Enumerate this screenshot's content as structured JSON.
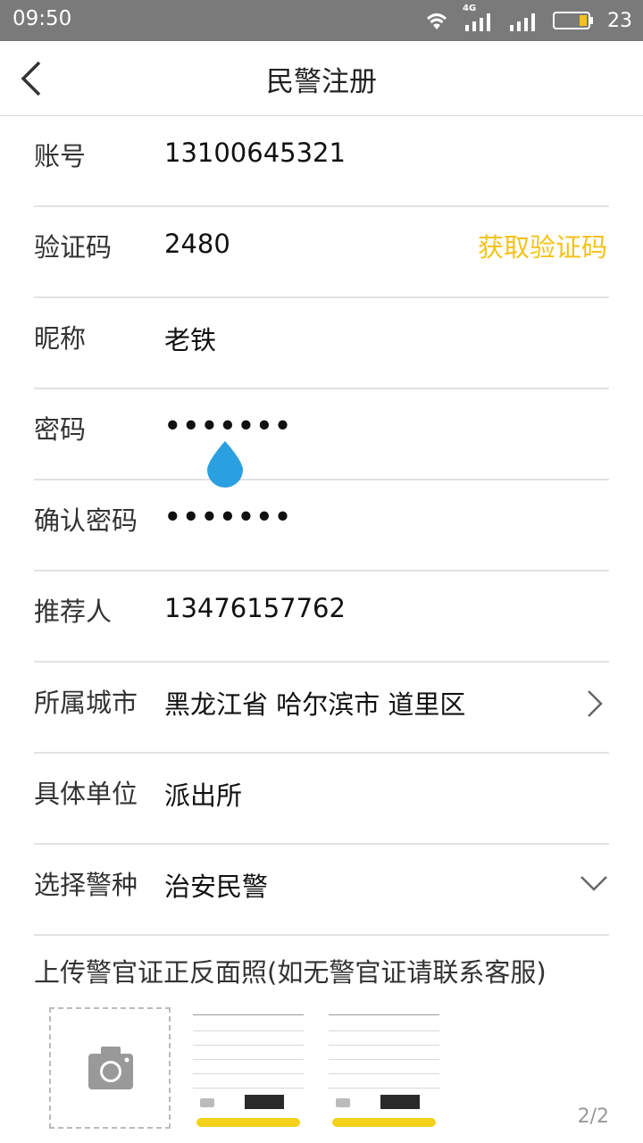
{
  "status_bar": {
    "time": "09:50",
    "battery": "23",
    "network": "4G"
  },
  "nav": {
    "title": "民警注册"
  },
  "form": {
    "account": {
      "label": "账号",
      "value": "13100645321"
    },
    "code": {
      "label": "验证码",
      "value": "2480",
      "action": "获取验证码"
    },
    "nickname": {
      "label": "昵称",
      "value": "老铁"
    },
    "password": {
      "label": "密码",
      "value": "•••••••"
    },
    "confirm": {
      "label": "确认密码",
      "value": "•••••••"
    },
    "referrer": {
      "label": "推荐人",
      "value": "13476157762"
    },
    "city": {
      "label": "所属城市",
      "value": "黑龙江省 哈尔滨市 道里区"
    },
    "unit": {
      "label": "具体单位",
      "value": "派出所"
    },
    "police_type": {
      "label": "选择警种",
      "value": "治安民警"
    }
  },
  "upload": {
    "title": "上传警官证正反面照(如无警官证请联系客服)"
  },
  "pager": "2/2",
  "colors": {
    "accent": "#f4c21a",
    "status_bar": "#7a7a7a",
    "drop": "#2aa0e0"
  }
}
